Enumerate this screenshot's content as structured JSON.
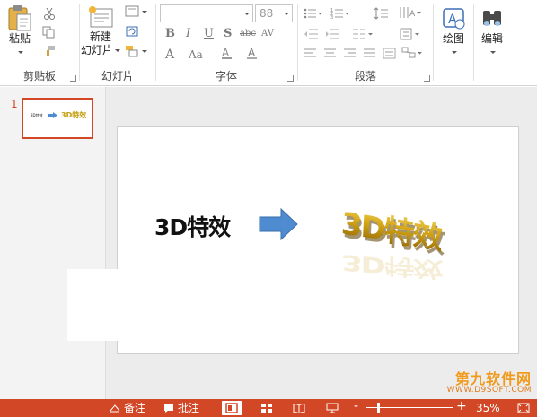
{
  "ribbon": {
    "clipboard": {
      "label": "剪贴板",
      "paste_label": "粘贴"
    },
    "slides": {
      "label": "幻灯片",
      "new_slide_line1": "新建",
      "new_slide_line2": "幻灯片"
    },
    "font": {
      "label": "字体",
      "font_name_value": "",
      "font_size_value": "88"
    },
    "paragraph": {
      "label": "段落"
    },
    "drawing": {
      "label": "绘图"
    },
    "editing": {
      "label": "编辑"
    }
  },
  "thumbnails": {
    "slide_number": "1",
    "title_text": "3D特效",
    "wordart_text": "3D特效"
  },
  "slide": {
    "title_text": "3D特效",
    "wordart_text": "3D特效"
  },
  "statusbar": {
    "notes_label": "备注",
    "comments_label": "批注",
    "zoom_minus": "-",
    "zoom_plus": "+",
    "zoom_percent": "35%"
  },
  "watermark": {
    "main": "第九软件网",
    "sub": "WWW.D9SOFT.COM"
  },
  "colors": {
    "accent": "#d24726",
    "wordart_gold": "#c59d0d",
    "arrow_blue": "#4f8bd0"
  },
  "icons": [
    "paste-icon",
    "cut-icon",
    "copy-icon",
    "format-painter-icon",
    "new-slide-icon",
    "layout-icon",
    "reset-icon",
    "section-icon",
    "drawing-icon",
    "find-icon",
    "notes-icon",
    "comments-icon",
    "normal-view-icon",
    "slide-sorter-icon",
    "reading-view-icon",
    "slideshow-icon",
    "fit-window-icon"
  ]
}
